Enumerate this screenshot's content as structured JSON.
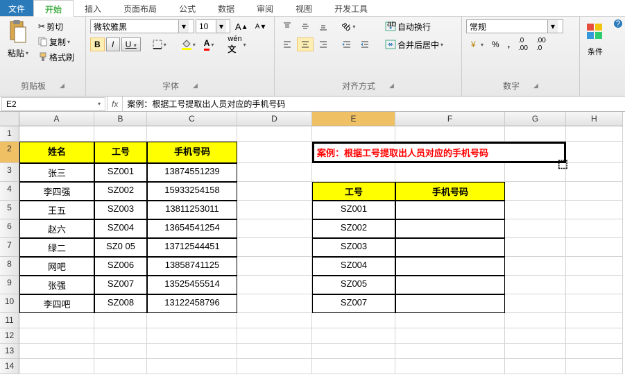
{
  "tabs": {
    "file": "文件",
    "home": "开始",
    "insert": "插入",
    "layout": "页面布局",
    "formula": "公式",
    "data": "数据",
    "review": "审阅",
    "view": "视图",
    "dev": "开发工具"
  },
  "clipboard": {
    "cut": "剪切",
    "copy": "复制",
    "brush": "格式刷",
    "paste": "粘贴",
    "label": "剪贴板"
  },
  "font": {
    "family": "微软雅黑",
    "size": "10",
    "bold": "B",
    "italic": "I",
    "underline": "U",
    "label": "字体"
  },
  "align": {
    "wrap": "自动换行",
    "merge": "合并后居中",
    "label": "对齐方式"
  },
  "number": {
    "format": "常规",
    "label": "数字"
  },
  "styles": {
    "cond": "条件"
  },
  "cellref": "E2",
  "formula": "案例：根据工号提取出人员对应的手机号码",
  "cols": [
    "A",
    "B",
    "C",
    "D",
    "E",
    "F",
    "G",
    "H"
  ],
  "rows": [
    "1",
    "2",
    "3",
    "4",
    "5",
    "6",
    "7",
    "8",
    "9",
    "10",
    "11",
    "12",
    "13",
    "14"
  ],
  "table1": {
    "h1": "姓名",
    "h2": "工号",
    "h3": "手机号码",
    "r": [
      [
        "张三",
        "SZ001",
        "13874551239"
      ],
      [
        "李四强",
        "SZ002",
        "15933254158"
      ],
      [
        "王五",
        "SZ003",
        "13811253011"
      ],
      [
        "赵六",
        "SZ004",
        "13654541254"
      ],
      [
        "绿二",
        "SZ0 05",
        "13712544451"
      ],
      [
        "网吧",
        "SZ006",
        "13858741125"
      ],
      [
        "张强",
        "SZ007",
        "13525455514"
      ],
      [
        "李四吧",
        "SZ008",
        "13122458796"
      ]
    ]
  },
  "title_text": "案例：根据工号提取出人员对应的手机号码",
  "table2": {
    "h1": "工号",
    "h2": "手机号码",
    "r": [
      "SZ001",
      "SZ002",
      "SZ003",
      "SZ004",
      "SZ005",
      "SZ007"
    ]
  }
}
